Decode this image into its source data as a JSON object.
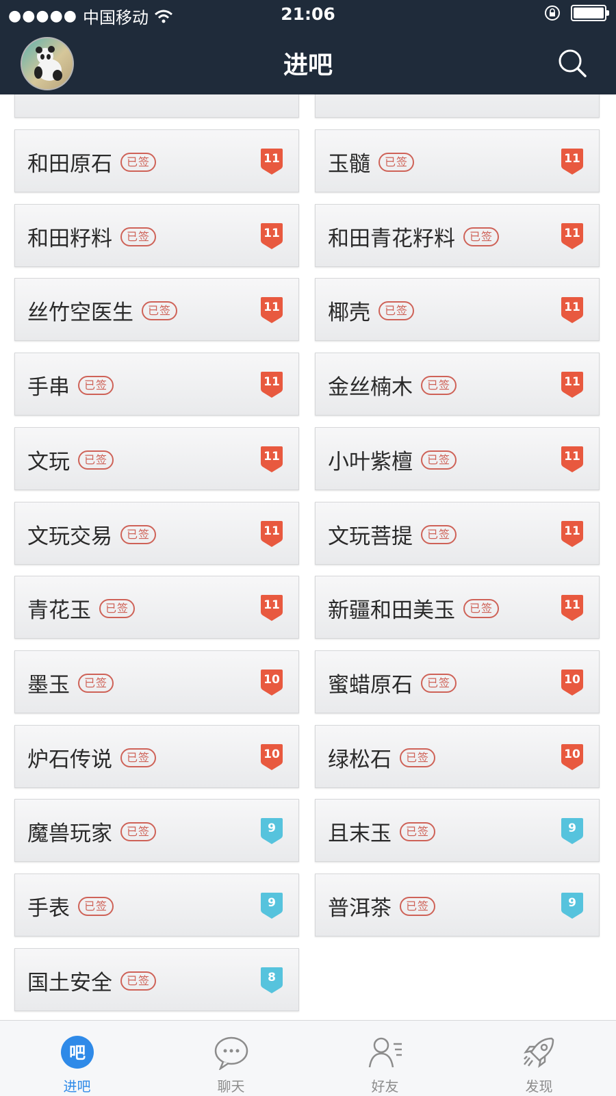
{
  "status_bar": {
    "carrier": "中国移动",
    "time": "21:06"
  },
  "header": {
    "title": "进吧"
  },
  "forums": [
    {
      "name": "和田原石",
      "stamp": "已签",
      "level": "11",
      "badge_color": "#e8593f"
    },
    {
      "name": "玉髓",
      "stamp": "已签",
      "level": "11",
      "badge_color": "#e8593f"
    },
    {
      "name": "和田籽料",
      "stamp": "已签",
      "level": "11",
      "badge_color": "#e8593f"
    },
    {
      "name": "和田青花籽料",
      "stamp": "已签",
      "level": "11",
      "badge_color": "#e8593f"
    },
    {
      "name": "丝竹空医生",
      "stamp": "已签",
      "level": "11",
      "badge_color": "#e8593f"
    },
    {
      "name": "椰壳",
      "stamp": "已签",
      "level": "11",
      "badge_color": "#e8593f"
    },
    {
      "name": "手串",
      "stamp": "已签",
      "level": "11",
      "badge_color": "#e8593f"
    },
    {
      "name": "金丝楠木",
      "stamp": "已签",
      "level": "11",
      "badge_color": "#e8593f"
    },
    {
      "name": "文玩",
      "stamp": "已签",
      "level": "11",
      "badge_color": "#e8593f"
    },
    {
      "name": "小叶紫檀",
      "stamp": "已签",
      "level": "11",
      "badge_color": "#e8593f"
    },
    {
      "name": "文玩交易",
      "stamp": "已签",
      "level": "11",
      "badge_color": "#e8593f"
    },
    {
      "name": "文玩菩提",
      "stamp": "已签",
      "level": "11",
      "badge_color": "#e8593f"
    },
    {
      "name": "青花玉",
      "stamp": "已签",
      "level": "11",
      "badge_color": "#e8593f"
    },
    {
      "name": "新疆和田美玉",
      "stamp": "已签",
      "level": "11",
      "badge_color": "#e8593f"
    },
    {
      "name": "墨玉",
      "stamp": "已签",
      "level": "10",
      "badge_color": "#e8593f"
    },
    {
      "name": "蜜蜡原石",
      "stamp": "已签",
      "level": "10",
      "badge_color": "#e8593f"
    },
    {
      "name": "炉石传说",
      "stamp": "已签",
      "level": "10",
      "badge_color": "#e8593f"
    },
    {
      "name": "绿松石",
      "stamp": "已签",
      "level": "10",
      "badge_color": "#e8593f"
    },
    {
      "name": "魔兽玩家",
      "stamp": "已签",
      "level": "9",
      "badge_color": "#56c3dd"
    },
    {
      "name": "且末玉",
      "stamp": "已签",
      "level": "9",
      "badge_color": "#56c3dd"
    },
    {
      "name": "手表",
      "stamp": "已签",
      "level": "9",
      "badge_color": "#56c3dd"
    },
    {
      "name": "普洱茶",
      "stamp": "已签",
      "level": "9",
      "badge_color": "#56c3dd"
    },
    {
      "name": "国土安全",
      "stamp": "已签",
      "level": "8",
      "badge_color": "#56c3dd"
    }
  ],
  "tabbar": {
    "tabs": [
      {
        "label": "进吧",
        "icon_char": "吧",
        "active": true
      },
      {
        "label": "聊天",
        "active": false
      },
      {
        "label": "好友",
        "active": false
      },
      {
        "label": "发现",
        "active": false
      }
    ],
    "active_color": "#2f8ae8"
  }
}
